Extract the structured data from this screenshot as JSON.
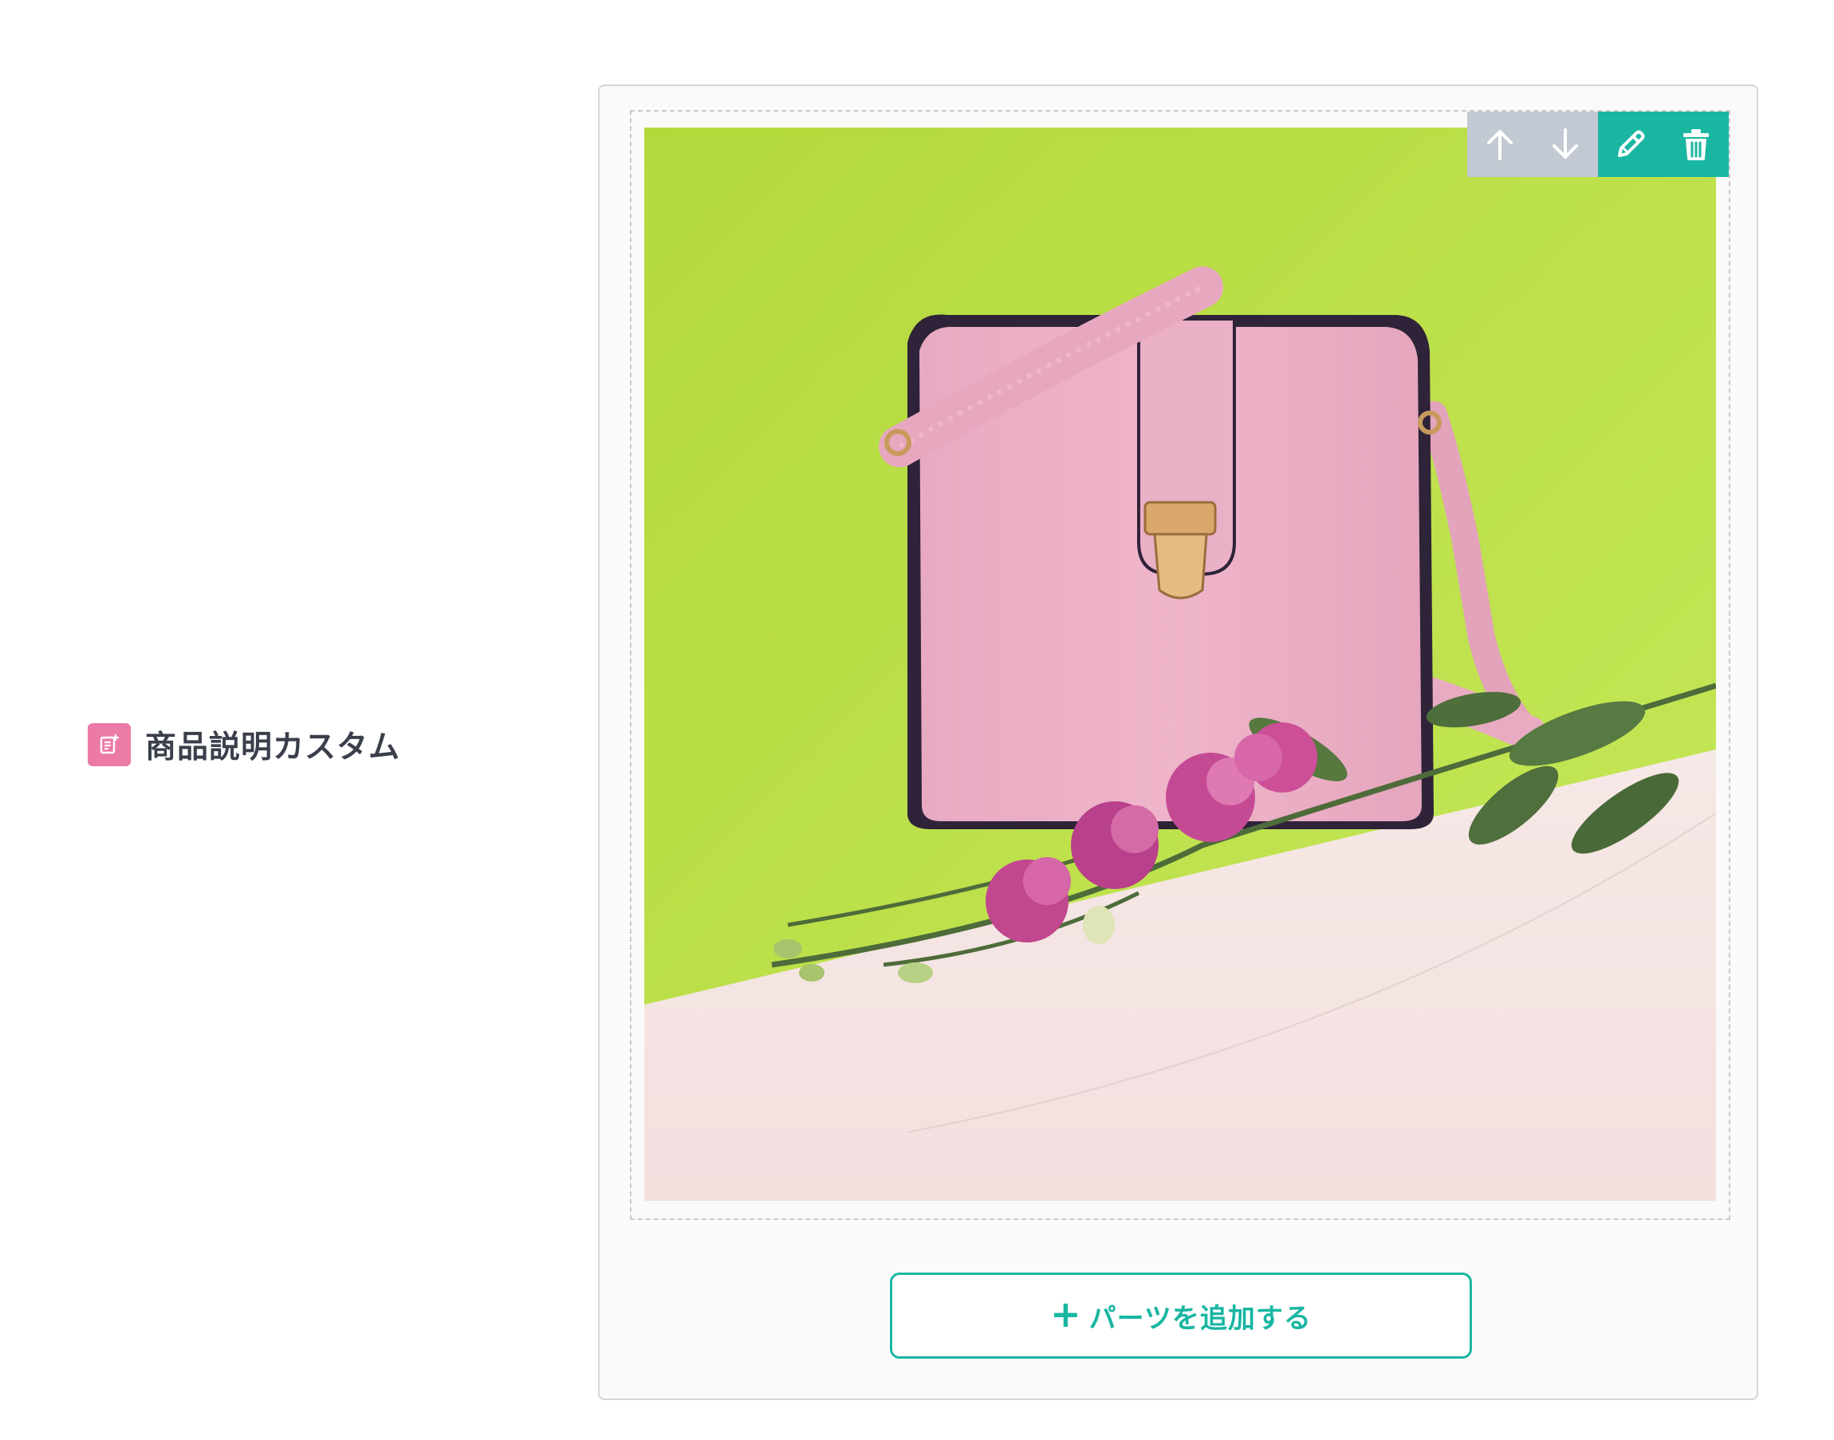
{
  "row": {
    "label": "商品説明カスタム",
    "icon": "document-add-icon",
    "icon_color": "#ec7aa6"
  },
  "block": {
    "image_alt": "pink leather crossbody bag with pink flowers on lime green background",
    "toolbar": {
      "move_up_icon": "arrow-up-icon",
      "move_down_icon": "arrow-down-icon",
      "edit_icon": "pencil-icon",
      "delete_icon": "trash-icon",
      "disabled_color": "#c3c9d2",
      "active_color": "#19b6a2"
    }
  },
  "add_part": {
    "plus": "+",
    "label": "パーツを追加する",
    "accent_color": "#19b6a2"
  }
}
